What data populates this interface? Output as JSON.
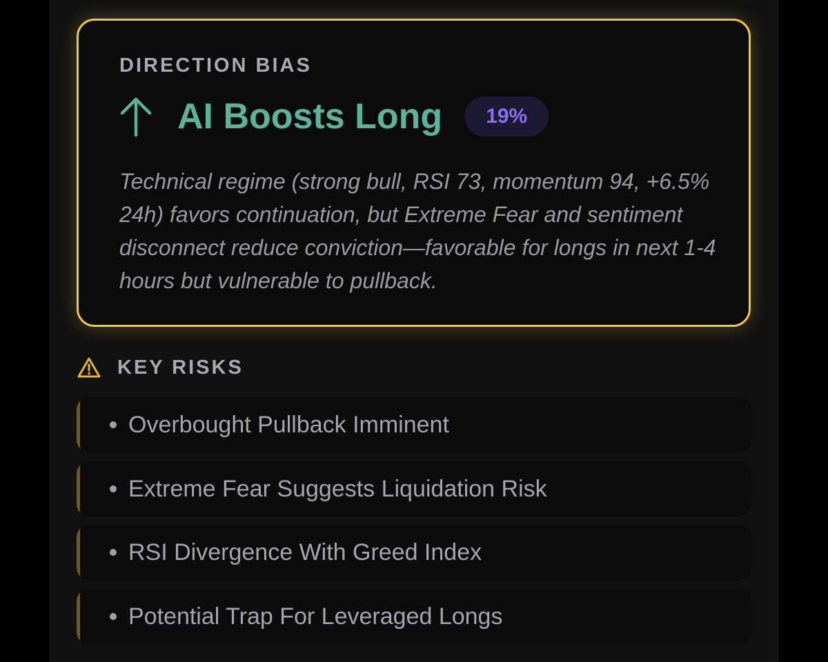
{
  "bias": {
    "label": "DIRECTION BIAS",
    "arrow_icon": "arrow-up-icon",
    "title": "AI Boosts Long",
    "percent": "19%",
    "description": "Technical regime (strong bull, RSI 73, momentum 94, +6.5% 24h) favors continuation, but Extreme Fear and sentiment disconnect reduce conviction—favorable for longs in next 1-4 hours but vulnerable to pullback."
  },
  "risks": {
    "icon": "warning-icon",
    "title": "KEY RISKS",
    "items": [
      "Overbought Pullback Imminent",
      "Extreme Fear Suggests Liquidation Risk",
      "RSI Divergence With Greed Index",
      "Potential Trap For Leveraged Longs"
    ]
  },
  "colors": {
    "card_border": "#f5c644",
    "bias_green": "#5db39a",
    "badge_purple": "#8d6ef2",
    "risk_accent": "#6e5a23",
    "warning": "#e8b339"
  }
}
